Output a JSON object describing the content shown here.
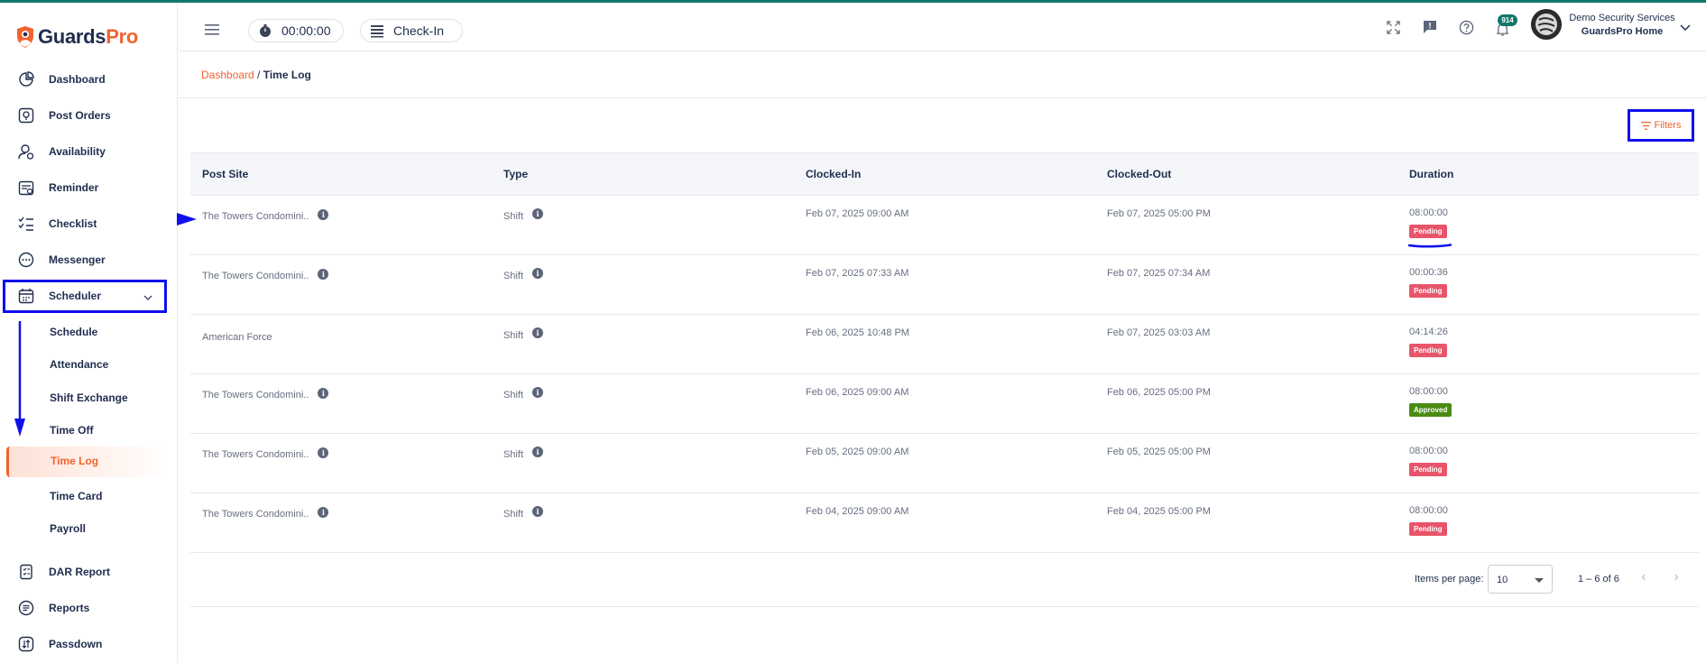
{
  "app": {
    "logo_part1": "Guards",
    "logo_part2": "Pro",
    "accent": "#f2622e",
    "brand_dark": "#1f2d4d",
    "teal": "#12776b"
  },
  "sidebar": {
    "items": [
      {
        "label": "Dashboard",
        "icon": "dashboard-icon"
      },
      {
        "label": "Post Orders",
        "icon": "post-orders-icon"
      },
      {
        "label": "Availability",
        "icon": "availability-icon"
      },
      {
        "label": "Reminder",
        "icon": "reminder-icon"
      },
      {
        "label": "Checklist",
        "icon": "checklist-icon"
      },
      {
        "label": "Messenger",
        "icon": "messenger-icon"
      },
      {
        "label": "Scheduler",
        "icon": "calendar-icon"
      }
    ],
    "scheduler_sub": [
      "Schedule",
      "Attendance",
      "Shift Exchange",
      "Time Off",
      "Time Log",
      "Time Card",
      "Payroll"
    ],
    "bottom_items": [
      {
        "label": "DAR Report",
        "icon": "dar-report-icon"
      },
      {
        "label": "Reports",
        "icon": "reports-icon"
      },
      {
        "label": "Passdown",
        "icon": "passdown-icon"
      }
    ]
  },
  "header": {
    "timer": "00:00:00",
    "checkin": "Check-In",
    "notification_count": "914",
    "org_name": "Demo Security Services",
    "org_home": "GuardsPro Home"
  },
  "breadcrumb": {
    "link": "Dashboard",
    "separator": " / ",
    "current": "Time Log"
  },
  "toolbar": {
    "filters_label": "Filters"
  },
  "table": {
    "headers": [
      "Post Site",
      "Type",
      "Clocked-In",
      "Clocked-Out",
      "Duration"
    ],
    "rows": [
      {
        "site": "The Towers Condomini..",
        "site_info": true,
        "type": "Shift",
        "in": "Feb 07, 2025 09:00 AM",
        "out": "Feb 07, 2025 05:00 PM",
        "duration": "08:00:00",
        "status": "Pending"
      },
      {
        "site": "The Towers Condomini..",
        "site_info": true,
        "type": "Shift",
        "in": "Feb 07, 2025 07:33 AM",
        "out": "Feb 07, 2025 07:34 AM",
        "duration": "00:00:36",
        "status": "Pending"
      },
      {
        "site": "American Force",
        "site_info": false,
        "type": "Shift",
        "in": "Feb 06, 2025 10:48 PM",
        "out": "Feb 07, 2025 03:03 AM",
        "duration": "04:14:26",
        "status": "Pending"
      },
      {
        "site": "The Towers Condomini..",
        "site_info": true,
        "type": "Shift",
        "in": "Feb 06, 2025 09:00 AM",
        "out": "Feb 06, 2025 05:00 PM",
        "duration": "08:00:00",
        "status": "Approved"
      },
      {
        "site": "The Towers Condomini..",
        "site_info": true,
        "type": "Shift",
        "in": "Feb 05, 2025 09:00 AM",
        "out": "Feb 05, 2025 05:00 PM",
        "duration": "08:00:00",
        "status": "Pending"
      },
      {
        "site": "The Towers Condomini..",
        "site_info": true,
        "type": "Shift",
        "in": "Feb 04, 2025 09:00 AM",
        "out": "Feb 04, 2025 05:00 PM",
        "duration": "08:00:00",
        "status": "Pending"
      }
    ],
    "status_colors": {
      "Pending": "#e8556a",
      "Approved": "#4a8c12"
    }
  },
  "pagination": {
    "items_per_page_label": "Items per page:",
    "items_per_page": "10",
    "range": "1 – 6 of 6"
  }
}
